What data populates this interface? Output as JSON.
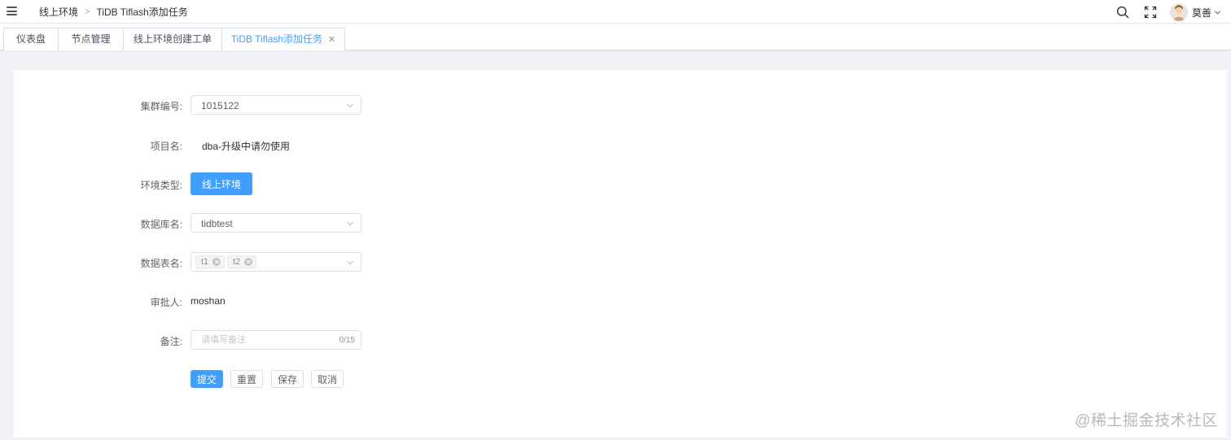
{
  "navbar": {
    "breadcrumb": [
      "线上环境",
      "TiDB Tiflash添加任务"
    ],
    "icons": [
      "hamburger-icon",
      "search-icon",
      "fullscreen-icon",
      "chevron-down-icon"
    ],
    "user_name": "莫善"
  },
  "tabs": [
    {
      "label": "仪表盘",
      "active": false
    },
    {
      "label": "节点管理",
      "active": false
    },
    {
      "label": "线上环境创建工单",
      "active": false
    },
    {
      "label": "TiDB Tiflash添加任务",
      "active": true,
      "closable": true
    }
  ],
  "form": {
    "cluster": {
      "label": "集群编号:",
      "value": "1015122"
    },
    "project": {
      "label": "项目名:",
      "value": "dba-升级中请勿使用"
    },
    "env": {
      "label": "环境类型:",
      "button": "线上环境"
    },
    "database": {
      "label": "数据库名:",
      "value": "tidbtest"
    },
    "tables": {
      "label": "数据表名:",
      "tags": [
        "t1",
        "t2"
      ]
    },
    "approver": {
      "label": "审批人:",
      "value": "moshan"
    },
    "remark": {
      "label": "备注:",
      "placeholder": "请填写备注",
      "counter": "0/15"
    },
    "actions": {
      "submit": "提交",
      "reset": "重置",
      "save": "保存",
      "cancel": "取消"
    }
  },
  "colors": {
    "primary": "#409eff",
    "background": "#f0f2f5"
  },
  "watermark": "@稀土掘金技术社区"
}
